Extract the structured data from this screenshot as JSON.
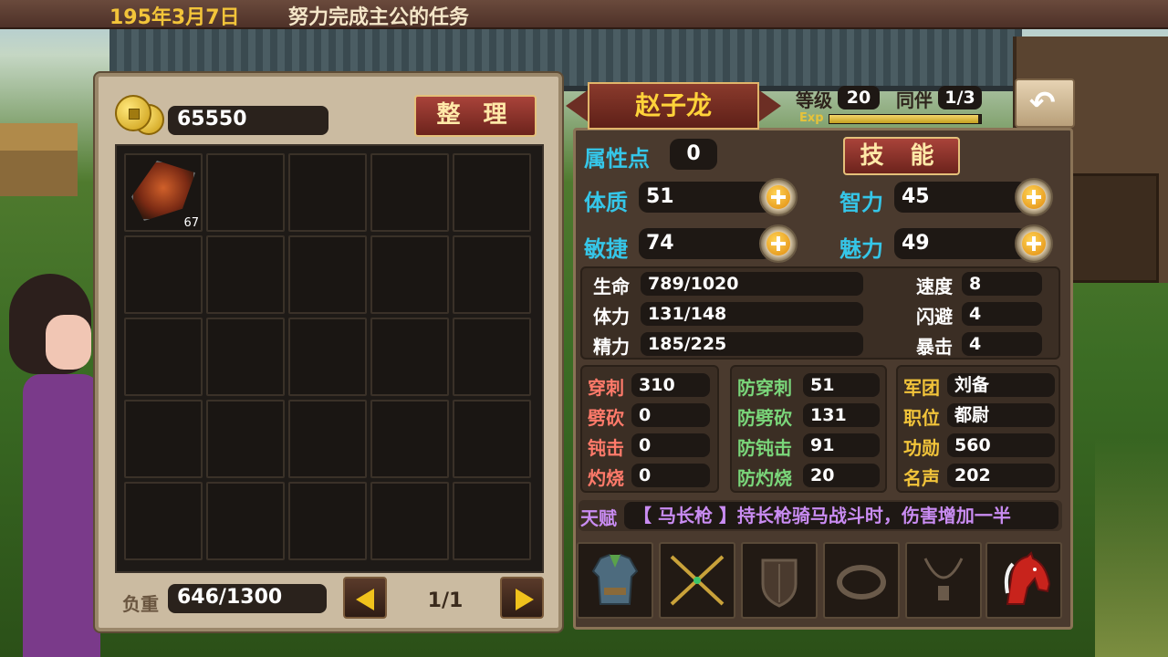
{
  "header": {
    "date": "195年3月7日",
    "task": "努力完成主公的任务"
  },
  "inventory": {
    "gold": "65550",
    "sort_label": "整 理",
    "item_qty": "67",
    "weight_label": "负重",
    "weight_value": "646/1300",
    "page": "1/1"
  },
  "character": {
    "name": "赵子龙",
    "level_label": "等级",
    "level": "20",
    "companion_label": "同伴",
    "companion": "1/3",
    "exp_label": "Exp",
    "exp_fraction": 0.98
  },
  "attributes": {
    "points_label": "属性点",
    "points": "0",
    "skill_label": "技 能",
    "constitution_label": "体质",
    "constitution": "51",
    "intelligence_label": "智力",
    "intelligence": "45",
    "agility_label": "敏捷",
    "agility": "74",
    "charm_label": "魅力",
    "charm": "49"
  },
  "vitals": {
    "hp_label": "生命",
    "hp": "789/1020",
    "stamina_label": "体力",
    "stamina": "131/148",
    "spirit_label": "精力",
    "spirit": "185/225",
    "speed_label": "速度",
    "speed": "8",
    "dodge_label": "闪避",
    "dodge": "4",
    "crit_label": "暴击",
    "crit": "4"
  },
  "offense": [
    {
      "label": "穿刺",
      "value": "310"
    },
    {
      "label": "劈砍",
      "value": "0"
    },
    {
      "label": "钝击",
      "value": "0"
    },
    {
      "label": "灼烧",
      "value": "0"
    }
  ],
  "defense": [
    {
      "label": "防穿刺",
      "value": "51"
    },
    {
      "label": "防劈砍",
      "value": "131"
    },
    {
      "label": "防钝击",
      "value": "91"
    },
    {
      "label": "防灼烧",
      "value": "20"
    }
  ],
  "info": [
    {
      "label": "军团",
      "value": "刘备"
    },
    {
      "label": "职位",
      "value": "都尉"
    },
    {
      "label": "功勋",
      "value": "560"
    },
    {
      "label": "名声",
      "value": "202"
    }
  ],
  "talent": {
    "label": "天赋",
    "text": "【 马长枪 】持长枪骑马战斗时，伤害增加一半"
  },
  "colors": {
    "cyan_label": "#35c6e8",
    "red_label": "#ff7a6a",
    "green_label": "#7ad67a",
    "gold_label": "#f2c43a",
    "talent": "#c98cf2"
  },
  "equipment": [
    "armor-icon",
    "weapon-icon",
    "shield-icon",
    "ring-icon",
    "necklace-icon",
    "horse-icon"
  ]
}
